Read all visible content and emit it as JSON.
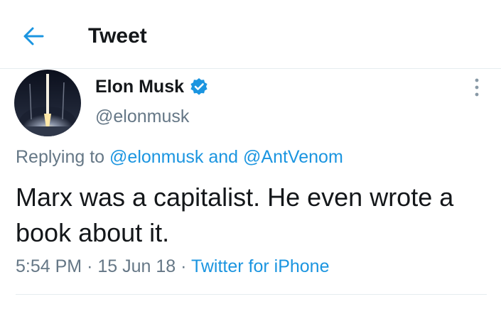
{
  "header": {
    "title": "Tweet",
    "back_icon": "arrow-left-icon"
  },
  "colors": {
    "accent": "#1b95e0",
    "text_primary": "#14171a",
    "text_secondary": "#657786",
    "divider": "#e6ecf0"
  },
  "tweet": {
    "author": {
      "name": "Elon Musk",
      "handle": "@elonmusk",
      "verified_icon": "verified-badge-icon",
      "avatar_icon": "rocket-launch-avatar"
    },
    "more_icon": "more-vertical-icon",
    "replying": {
      "prefix": "Replying to",
      "user1": "@elonmusk",
      "conjunction": "and",
      "user2": "@AntVenom"
    },
    "text": "Marx was a capitalist. He even wrote a book about it.",
    "meta": {
      "time": "5:54 PM",
      "date": "15 Jun 18",
      "separator": "·",
      "source": "Twitter for iPhone"
    }
  }
}
